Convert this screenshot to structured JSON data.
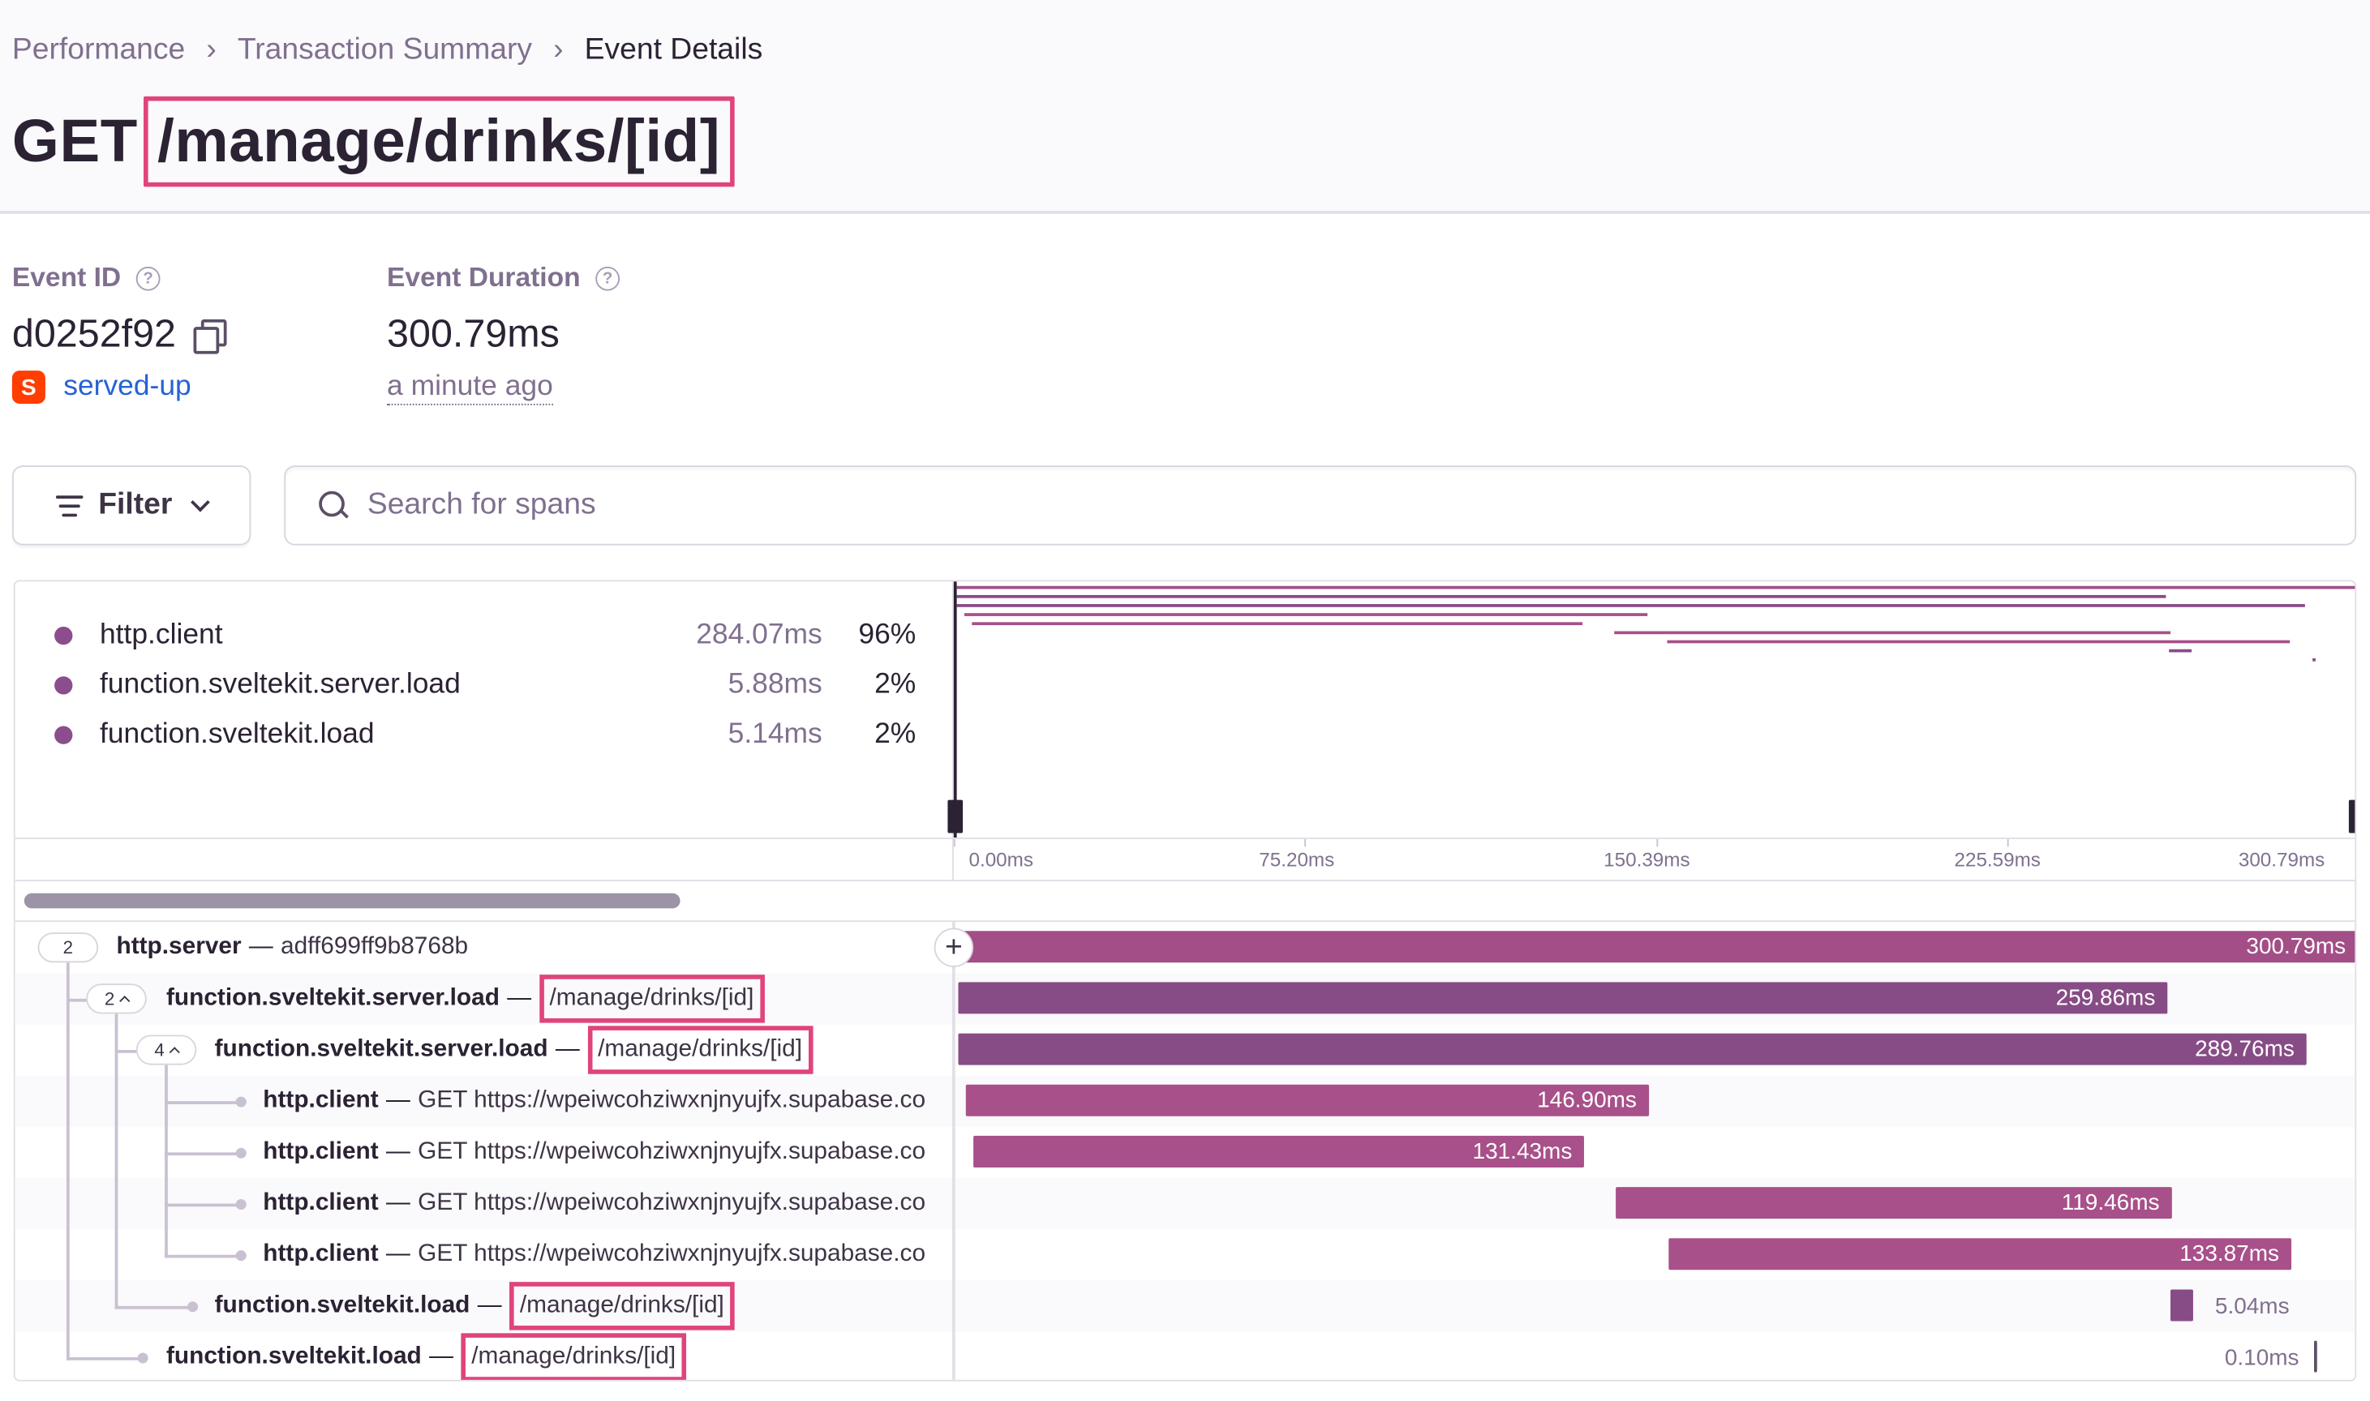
{
  "breadcrumbs": [
    "Performance",
    "Transaction Summary",
    "Event Details"
  ],
  "title": {
    "method": "GET",
    "route": "/manage/drinks/[id]"
  },
  "event": {
    "id_label": "Event ID",
    "id_value": "d0252f92",
    "project": "served-up",
    "duration_label": "Event Duration",
    "duration_value": "300.79ms",
    "time_ago": "a minute ago"
  },
  "toolbar": {
    "filter_label": "Filter",
    "search_placeholder": "Search for spans"
  },
  "ops_breakdown": [
    {
      "name": "http.client",
      "duration": "284.07ms",
      "percent": "96%"
    },
    {
      "name": "function.sveltekit.server.load",
      "duration": "5.88ms",
      "percent": "2%"
    },
    {
      "name": "function.sveltekit.load",
      "duration": "5.14ms",
      "percent": "2%"
    }
  ],
  "axis_ticks": [
    "0.00ms",
    "75.20ms",
    "150.39ms",
    "225.59ms",
    "300.79ms"
  ],
  "spans": [
    {
      "op": "http.server",
      "desc": "adff699ff9b8768b",
      "children_count": "2",
      "duration_label": "300.79ms",
      "start_ms": 0.0,
      "duration_ms": 300.79,
      "color": "#a34e87"
    },
    {
      "op": "function.sveltekit.server.load",
      "desc": "/manage/drinks/[id]",
      "children_count": "2",
      "duration_label": "259.86ms",
      "start_ms": 0.0,
      "duration_ms": 259.86,
      "color": "#874c86"
    },
    {
      "op": "function.sveltekit.server.load",
      "desc": "/manage/drinks/[id]",
      "children_count": "4",
      "duration_label": "289.76ms",
      "start_ms": 0.0,
      "duration_ms": 289.76,
      "color": "#874c86"
    },
    {
      "op": "http.client",
      "desc": "GET https://wpeiwcohziwxnjnyujfx.supabase.co",
      "duration_label": "146.90ms",
      "start_ms": 1.5,
      "duration_ms": 146.9,
      "color": "#a8508a"
    },
    {
      "op": "http.client",
      "desc": "GET https://wpeiwcohziwxnjnyujfx.supabase.co",
      "duration_label": "131.43ms",
      "start_ms": 3.1,
      "duration_ms": 131.43,
      "color": "#a8508a"
    },
    {
      "op": "http.client",
      "desc": "GET https://wpeiwcohziwxnjnyujfx.supabase.co",
      "duration_label": "119.46ms",
      "start_ms": 141.3,
      "duration_ms": 119.46,
      "color": "#a8508a"
    },
    {
      "op": "http.client",
      "desc": "GET https://wpeiwcohziwxnjnyujfx.supabase.co",
      "duration_label": "133.87ms",
      "start_ms": 152.6,
      "duration_ms": 133.87,
      "color": "#a8508a"
    },
    {
      "op": "function.sveltekit.load",
      "desc": "/manage/drinks/[id]",
      "duration_label": "5.04ms",
      "start_ms": 260.5,
      "duration_ms": 5.04,
      "color": "#874c86"
    },
    {
      "op": "function.sveltekit.load",
      "desc": "/manage/drinks/[id]",
      "duration_label": "0.10ms",
      "start_ms": 291.4,
      "duration_ms": 0.1,
      "color": "#874c86"
    }
  ],
  "colors": {
    "accent_highlight": "#e0447c",
    "link": "#2562d4",
    "op_dot": "#8b4d8e"
  }
}
